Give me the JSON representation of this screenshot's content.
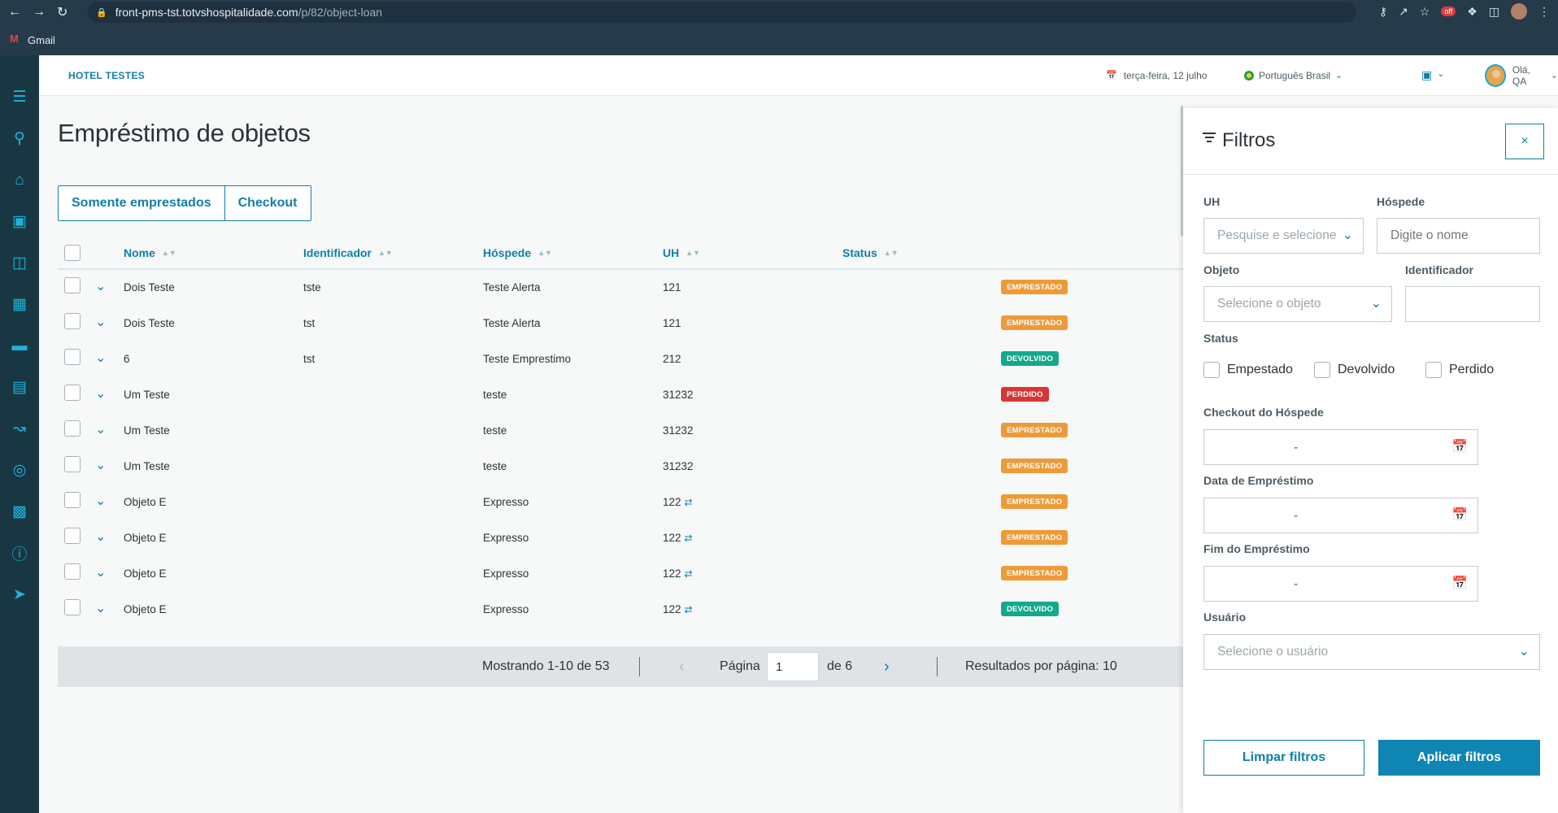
{
  "browser": {
    "url_host": "front-pms-tst.totvshospitalidade.com",
    "url_path": "/p/82/object-loan",
    "bookmark_gmail": "Gmail",
    "ext_badge": "off"
  },
  "header": {
    "hotel_name": "HOTEL TESTES",
    "date": "terça-feira, 12 julho",
    "language": "Português Brasil",
    "greeting": "Olá, QA"
  },
  "page": {
    "title": "Empréstimo de objetos",
    "toggle_only_loaned": "Somente emprestados",
    "toggle_checkout": "Checkout"
  },
  "table": {
    "columns": [
      "Nome",
      "Identificador",
      "Hóspede",
      "UH",
      "Status"
    ],
    "rows": [
      {
        "nome": "Dois Teste",
        "identificador": "tste",
        "hospede": "Teste Alerta",
        "uh": "121",
        "status": "EMPRESTADO",
        "status_key": "emprestado",
        "sync": false
      },
      {
        "nome": "Dois Teste",
        "identificador": "tst",
        "hospede": "Teste Alerta",
        "uh": "121",
        "status": "EMPRESTADO",
        "status_key": "emprestado",
        "sync": false
      },
      {
        "nome": "6",
        "identificador": "tst",
        "hospede": "Teste Emprestimo",
        "uh": "212",
        "status": "DEVOLVIDO",
        "status_key": "devolvido",
        "sync": false
      },
      {
        "nome": "Um Teste",
        "identificador": "",
        "hospede": "teste",
        "uh": "31232",
        "status": "PERDIDO",
        "status_key": "perdido",
        "sync": false
      },
      {
        "nome": "Um Teste",
        "identificador": "",
        "hospede": "teste",
        "uh": "31232",
        "status": "EMPRESTADO",
        "status_key": "emprestado",
        "sync": false
      },
      {
        "nome": "Um Teste",
        "identificador": "",
        "hospede": "teste",
        "uh": "31232",
        "status": "EMPRESTADO",
        "status_key": "emprestado",
        "sync": false
      },
      {
        "nome": "Objeto E",
        "identificador": "",
        "hospede": "Expresso",
        "uh": "122",
        "status": "EMPRESTADO",
        "status_key": "emprestado",
        "sync": true
      },
      {
        "nome": "Objeto E",
        "identificador": "",
        "hospede": "Expresso",
        "uh": "122",
        "status": "EMPRESTADO",
        "status_key": "emprestado",
        "sync": true
      },
      {
        "nome": "Objeto E",
        "identificador": "",
        "hospede": "Expresso",
        "uh": "122",
        "status": "EMPRESTADO",
        "status_key": "emprestado",
        "sync": true
      },
      {
        "nome": "Objeto E",
        "identificador": "",
        "hospede": "Expresso",
        "uh": "122",
        "status": "DEVOLVIDO",
        "status_key": "devolvido",
        "sync": true
      }
    ]
  },
  "pager": {
    "showing": "Mostrando 1-10 de 53",
    "page_label": "Página",
    "page_value": "1",
    "of_label": "de 6",
    "per_page": "Resultados por página: 10"
  },
  "filters": {
    "title": "Filtros",
    "close": "×",
    "uh_label": "UH",
    "uh_placeholder": "Pesquise e selecione",
    "guest_label": "Hóspede",
    "guest_placeholder": "Digite o nome",
    "object_label": "Objeto",
    "object_placeholder": "Selecione o objeto",
    "identifier_label": "Identificador",
    "identifier_value": "",
    "status_label": "Status",
    "status_options": [
      "Empestado",
      "Devolvido",
      "Perdido"
    ],
    "checkout_label": "Checkout do Hóspede",
    "loan_date_label": "Data de Empréstimo",
    "loan_end_label": "Fim do Empréstimo",
    "date_placeholder": "-",
    "user_label": "Usuário",
    "user_placeholder": "Selecione o usuário",
    "clear_button": "Limpar filtros",
    "apply_button": "Aplicar filtros"
  },
  "colors": {
    "primary": "#0f7fa8",
    "sidebar": "#193743",
    "emprestado": "#ee9a38",
    "devolvido": "#14a98b",
    "perdido": "#d73636"
  }
}
